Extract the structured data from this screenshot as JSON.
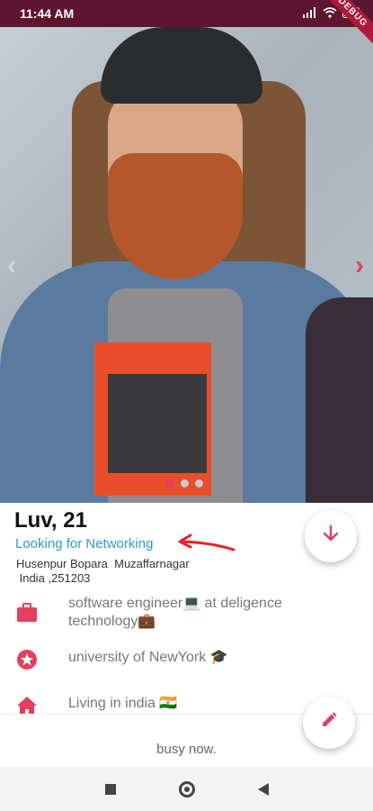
{
  "status_bar": {
    "time": "11:44 AM",
    "battery": "",
    "debug_label": "DEBUG"
  },
  "profile": {
    "name": "Luv, 21",
    "looking_for": "Looking for Networking",
    "address": "Husenpur Bopara  Muzaffarnagar\n India ,251203",
    "photo_count": 3,
    "active_photo_index": 0
  },
  "info": {
    "job": "software engineer💻 at deligence technology💼",
    "education": "university of NewYork 🎓",
    "living": "Living in india 🇮🇳"
  },
  "status_text": "busy now.",
  "colors": {
    "accent": "#e53e5f",
    "link": "#2b9cc8",
    "status_bar": "#5e1630"
  },
  "icons": {
    "job": "briefcase-icon",
    "education": "star-badge-icon",
    "living": "home-icon",
    "next": "chevron-right-icon",
    "prev": "chevron-left-icon",
    "scroll_down": "arrow-down-icon",
    "edit": "pencil-icon"
  }
}
